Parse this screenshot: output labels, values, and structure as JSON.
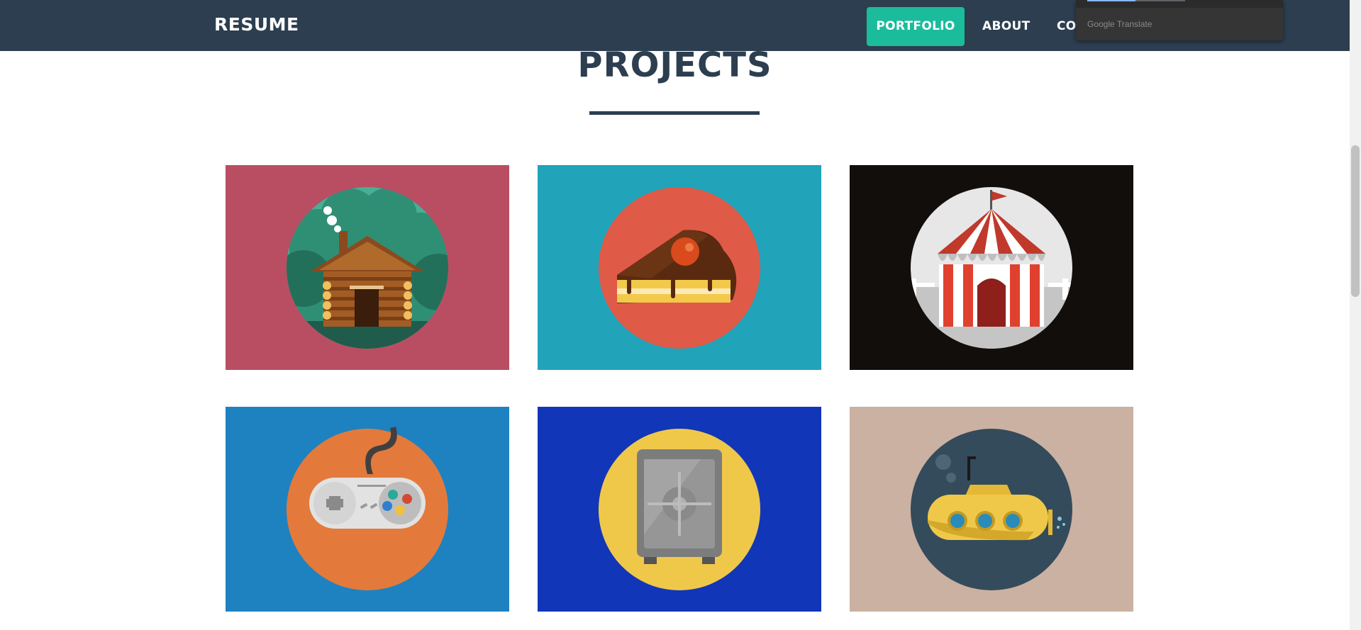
{
  "navbar": {
    "brand": "RESUME",
    "items": [
      {
        "label": "PORTFOLIO",
        "active": true
      },
      {
        "label": "ABOUT",
        "active": false
      },
      {
        "label": "CONTACT",
        "active": false
      }
    ]
  },
  "translate_popup": {
    "label": "Google Translate"
  },
  "section": {
    "title": "PROJECTS"
  },
  "projects": [
    {
      "icon": "cabin-icon",
      "bg": "#b94e62"
    },
    {
      "icon": "cake-icon",
      "bg": "#21a3b9"
    },
    {
      "icon": "circus-tent-icon",
      "bg": "#120e0c"
    },
    {
      "icon": "game-controller-icon",
      "bg": "#1e82c0"
    },
    {
      "icon": "safe-icon",
      "bg": "#1236b8"
    },
    {
      "icon": "submarine-icon",
      "bg": "#cbb1a2"
    }
  ],
  "colors": {
    "navbar": "#2c3e50",
    "accent": "#1abc9c",
    "title": "#2c3e50"
  }
}
